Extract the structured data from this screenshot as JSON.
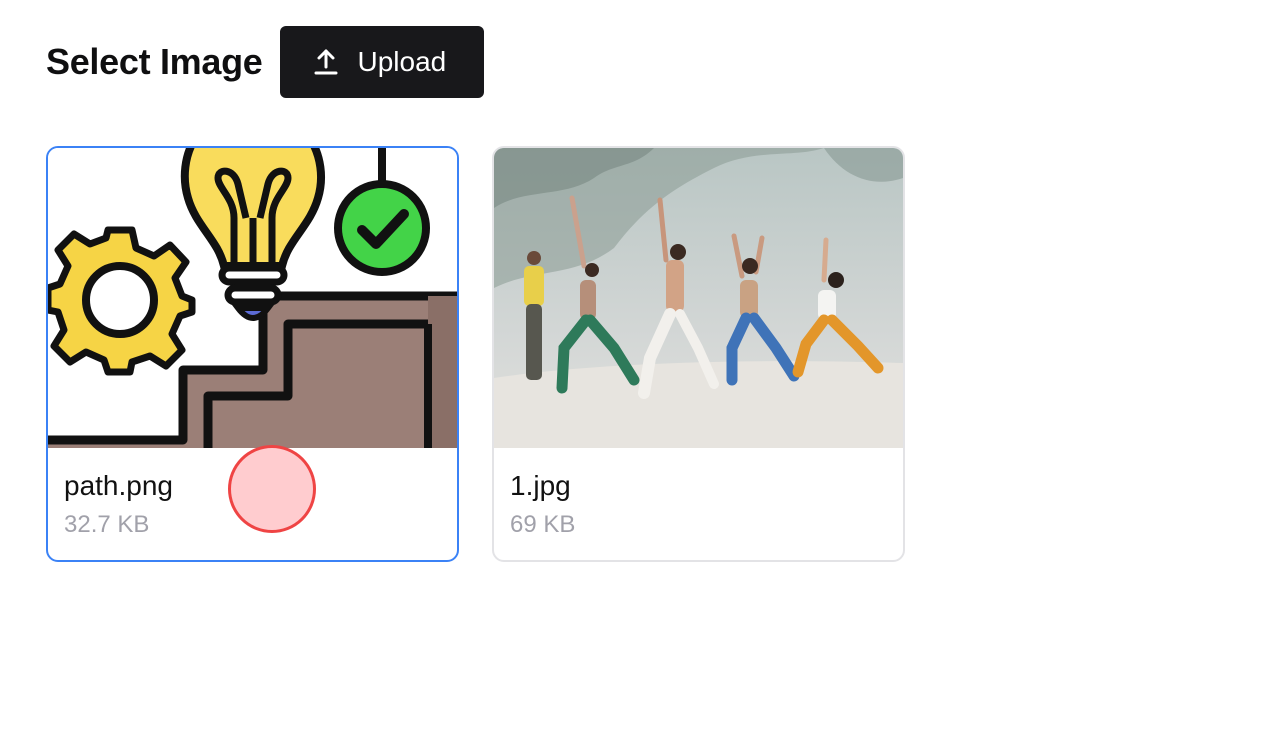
{
  "header": {
    "title": "Select Image",
    "upload_label": "Upload",
    "upload_icon": "upload-icon"
  },
  "images": [
    {
      "name": "path.png",
      "size": "32.7 KB",
      "selected": true
    },
    {
      "name": "1.jpg",
      "size": "69 KB",
      "selected": false
    }
  ],
  "colors": {
    "accent": "#3b82f6",
    "button_bg": "#18181b",
    "muted_text": "#a1a1aa",
    "cursor": "#ef4444"
  }
}
